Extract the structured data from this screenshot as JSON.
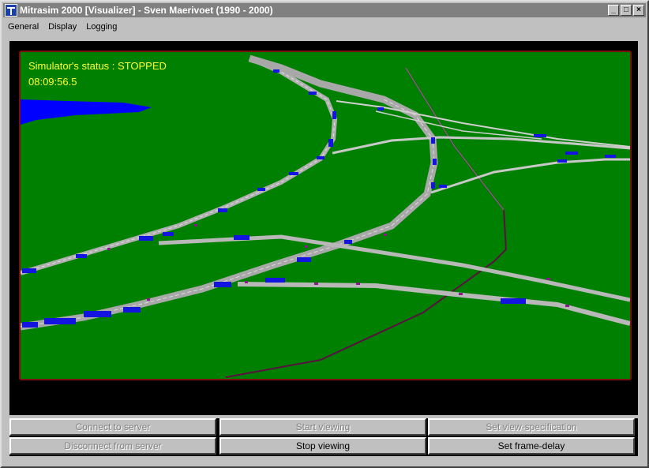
{
  "window": {
    "title": "Mitrasim 2000 [Visualizer] - Sven Maerivoet (1990 - 2000)"
  },
  "menu": [
    "General",
    "Display",
    "Logging"
  ],
  "status": {
    "line1": "Simulator's status : STOPPED",
    "time": "08:09:56.5"
  },
  "buttons": {
    "connect": "Connect to server",
    "start": "Start viewing",
    "set_view": "Set view-specification",
    "disconnect": "Disconnect from server",
    "stop": "Stop viewing",
    "set_delay": "Set frame-delay"
  },
  "colors": {
    "ground": "#008000",
    "water": "#0000ff",
    "road": "#c0c0c0",
    "vehicle": "#1414e0",
    "status_text": "#ffff33"
  }
}
